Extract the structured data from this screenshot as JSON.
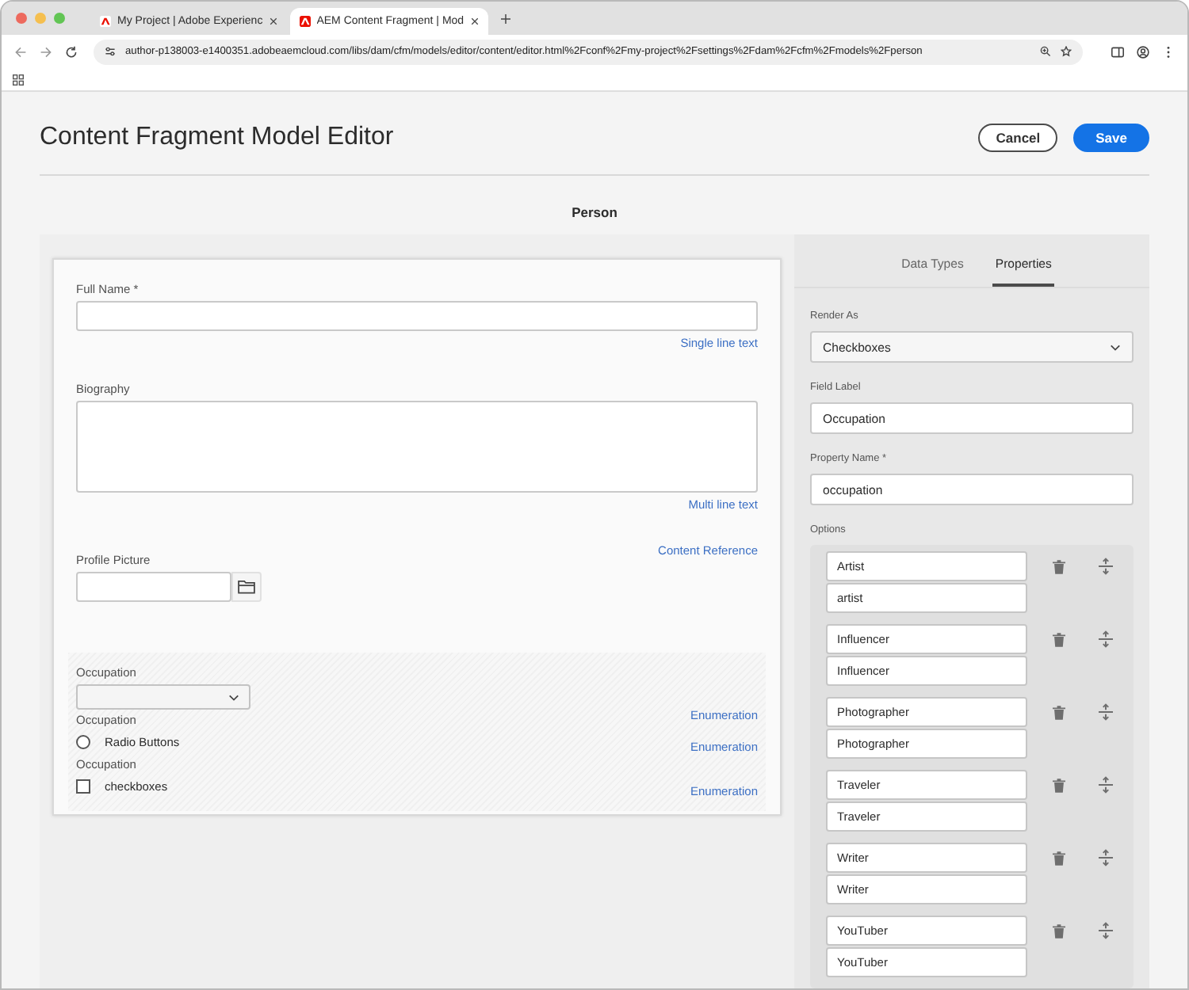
{
  "browser": {
    "tabs": [
      {
        "title": "My Project | Adobe Experienc",
        "selected": false
      },
      {
        "title": "AEM Content Fragment | Mod",
        "selected": true
      }
    ],
    "url": "author-p138003-e1400351.adobeaemcloud.com/libs/dam/cfm/models/editor/content/editor.html%2Fconf%2Fmy-project%2Fsettings%2Fdam%2Fcfm%2Fmodels%2Fperson"
  },
  "header": {
    "title": "Content Fragment Model Editor",
    "buttons": [
      {
        "label": "Cancel",
        "kind": "secondary"
      },
      {
        "label": "Save",
        "kind": "primary"
      }
    ]
  },
  "model_name": "Person",
  "form": {
    "fields": [
      {
        "kind": "text",
        "label": "Full Name *",
        "type_label": "Single line text"
      },
      {
        "kind": "multiline",
        "label": "Biography",
        "type_label": "Multi line text"
      },
      {
        "kind": "reference",
        "label": "Profile Picture",
        "type_label": "Content Reference"
      },
      {
        "kind": "enumeration",
        "items": [
          {
            "kind": "dropdown",
            "label": "Occupation",
            "type_label": "Enumeration"
          },
          {
            "kind": "radio",
            "label": "Occupation",
            "option": "Radio Buttons",
            "checked": false,
            "type_label": "Enumeration"
          },
          {
            "kind": "checkbox",
            "label": "Occupation",
            "option": "checkboxes",
            "checked": false,
            "type_label": "Enumeration"
          }
        ]
      }
    ]
  },
  "properties": {
    "tabs": [
      {
        "label": "Data Types",
        "selected": false
      },
      {
        "label": "Properties",
        "selected": true
      }
    ],
    "render_as": {
      "label": "Render As",
      "value": "Checkboxes"
    },
    "field_label": {
      "label": "Field Label",
      "value": "Occupation"
    },
    "property_name": {
      "label": "Property Name *",
      "value": "occupation"
    },
    "options_label": "Options",
    "options": [
      {
        "label": "Artist",
        "value": "artist"
      },
      {
        "label": "Influencer",
        "value": "Influencer"
      },
      {
        "label": "Photographer",
        "value": "Photographer"
      },
      {
        "label": "Traveler",
        "value": "Traveler"
      },
      {
        "label": "Writer",
        "value": "Writer"
      },
      {
        "label": "YouTuber",
        "value": "YouTuber"
      }
    ]
  }
}
